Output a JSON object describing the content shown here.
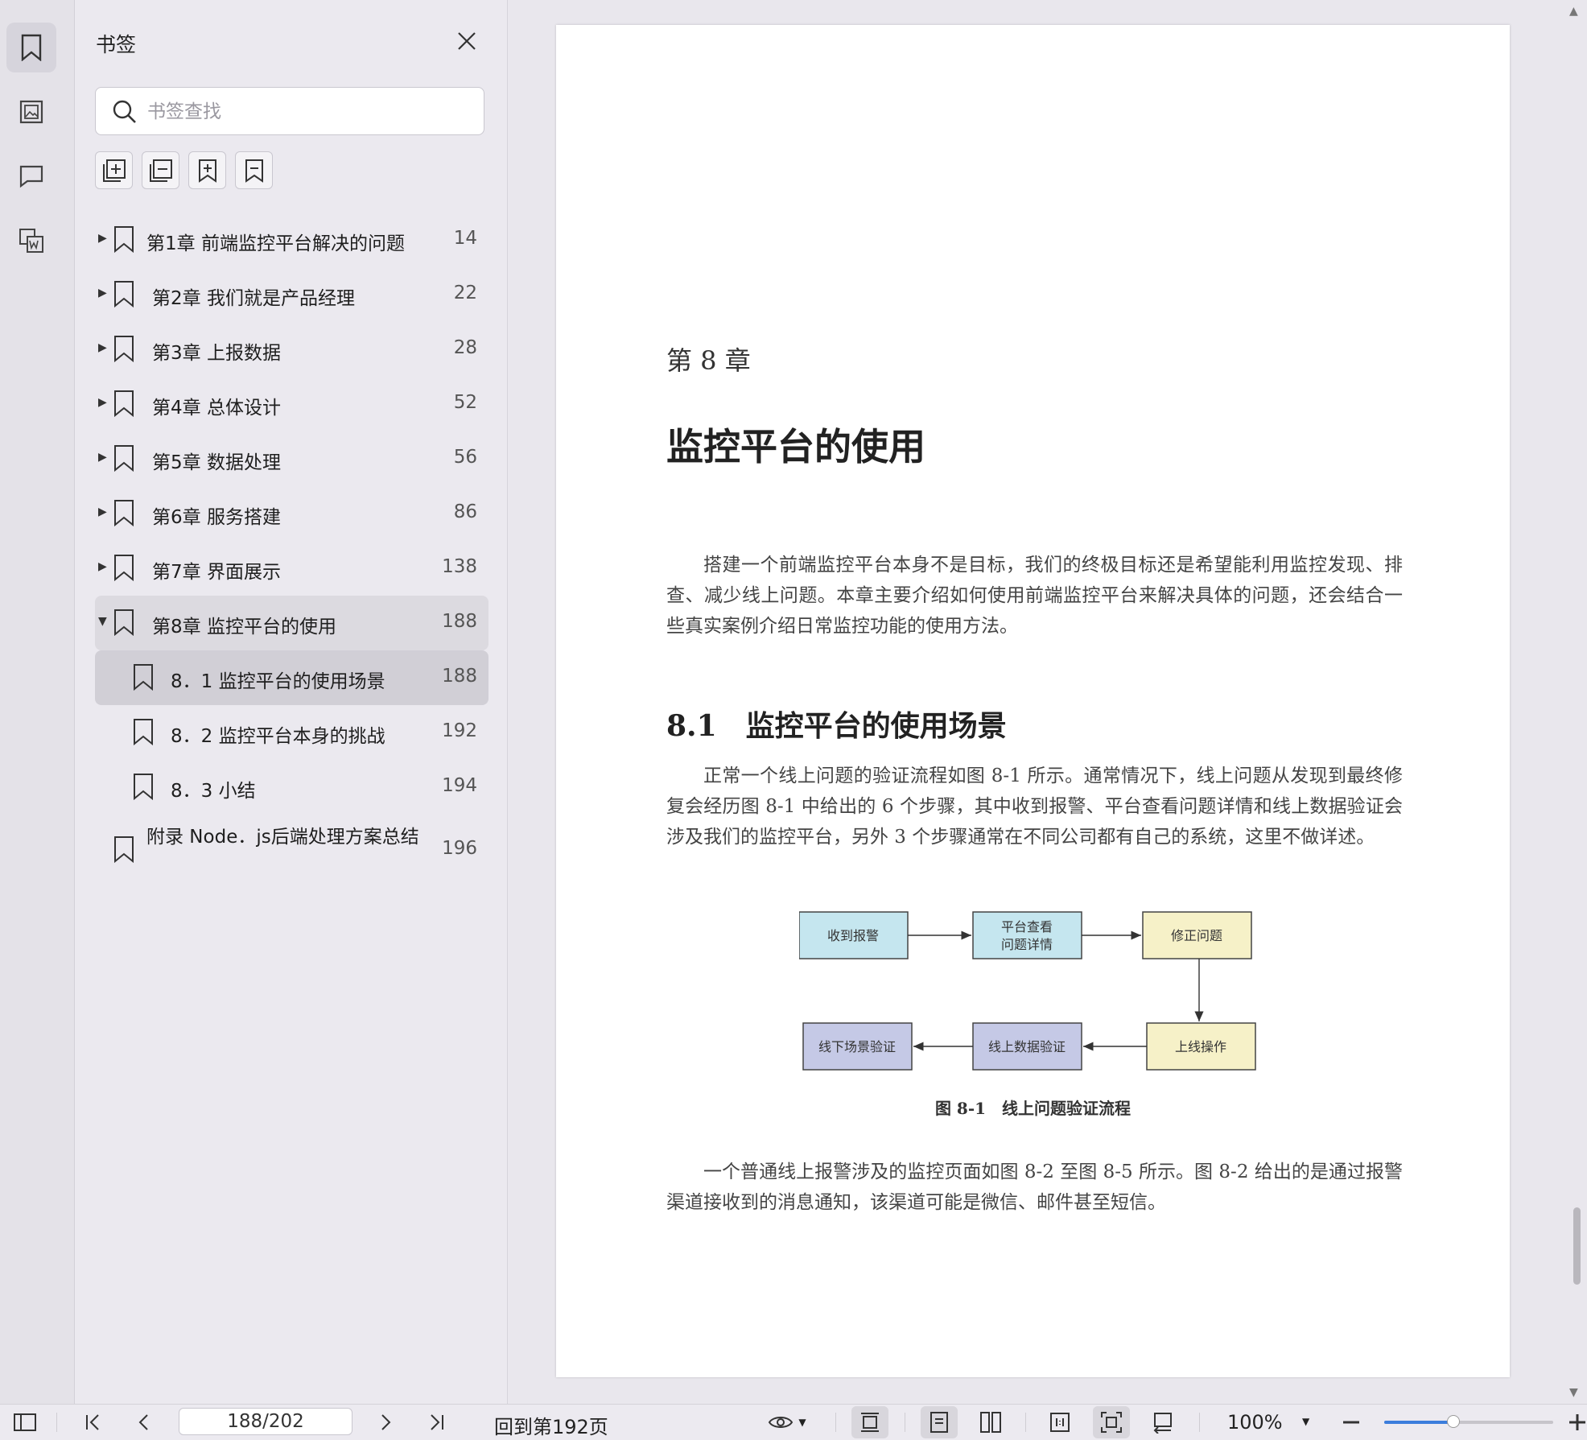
{
  "panel": {
    "title": "书签",
    "search_placeholder": "书签查找",
    "tools": [
      "expand-all-icon",
      "collapse-all-icon",
      "add-bookmark-icon",
      "delete-bookmark-icon"
    ]
  },
  "bookmarks": [
    {
      "label": "第1章 前端监控平台解决的问题",
      "page": "14"
    },
    {
      "label": "第2章 我们就是产品经理",
      "page": "22"
    },
    {
      "label": "第3章 上报数据",
      "page": "28"
    },
    {
      "label": "第4章 总体设计",
      "page": "52"
    },
    {
      "label": "第5章 数据处理",
      "page": "56"
    },
    {
      "label": "第6章 服务搭建",
      "page": "86"
    },
    {
      "label": "第7章 界面展示",
      "page": "138"
    },
    {
      "label": "第8章 监控平台的使用",
      "page": "188"
    },
    {
      "label": "8．1 监控平台的使用场景",
      "page": "188"
    },
    {
      "label": "8．2 监控平台本身的挑战",
      "page": "192"
    },
    {
      "label": "8．3 小结",
      "page": "194"
    },
    {
      "label": "附录 Node．js后端处理方案总结",
      "page": "196"
    }
  ],
  "document": {
    "chapter_number": "第 8 章",
    "chapter_title": "监控平台的使用",
    "intro": "搭建一个前端监控平台本身不是目标，我们的终极目标还是希望能利用监控发现、排查、减少线上问题。本章主要介绍如何使用前端监控平台来解决具体的问题，还会结合一些真实案例介绍日常监控功能的使用方法。",
    "section_number": "8.1",
    "section_title": "监控平台的使用场景",
    "para1": "正常一个线上问题的验证流程如图 8-1 所示。通常情况下，线上问题从发现到最终修复会经历图 8-1 中给出的 6 个步骤，其中收到报警、平台查看问题详情和线上数据验证会涉及我们的监控平台，另外 3 个步骤通常在不同公司都有自己的系统，这里不做详述。",
    "figure": {
      "boxes": [
        "收到报警",
        "平台查看",
        "问题详情",
        "修正问题",
        "上线操作",
        "线上数据验证",
        "线下场景验证"
      ],
      "caption": "图 8-1　线上问题验证流程"
    },
    "para2": "一个普通线上报警涉及的监控页面如图 8-2 至图 8-5 所示。图 8-2 给出的是通过报警渠道接收到的消息通知，该渠道可能是微信、邮件甚至短信。"
  },
  "toolbar": {
    "page_indicator": "188/202",
    "goto_label": "回到第192页",
    "zoom_label": "100%",
    "zoom_fraction": 0.41
  },
  "colors": {
    "box_cyan": "#c5e6ef",
    "box_yellow": "#f6f1c8",
    "box_lavender": "#c5c9e6",
    "accent": "#3b7ddc"
  }
}
